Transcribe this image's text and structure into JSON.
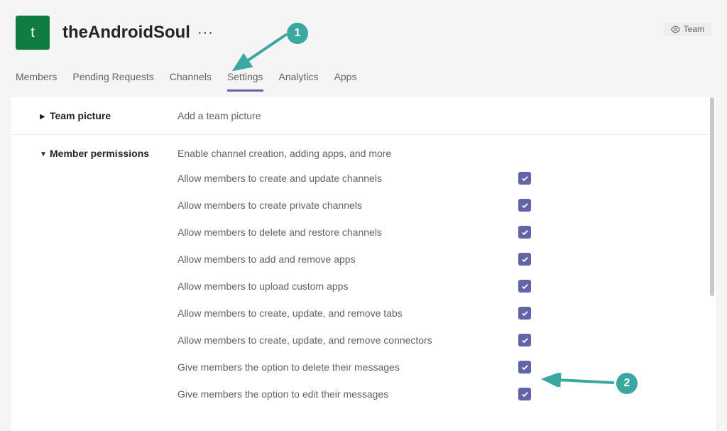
{
  "header": {
    "avatar_letter": "t",
    "team_name": "theAndroidSoul",
    "more": "···",
    "badge_label": "Team"
  },
  "tabs": [
    {
      "label": "Members",
      "active": false
    },
    {
      "label": "Pending Requests",
      "active": false
    },
    {
      "label": "Channels",
      "active": false
    },
    {
      "label": "Settings",
      "active": true
    },
    {
      "label": "Analytics",
      "active": false
    },
    {
      "label": "Apps",
      "active": false
    }
  ],
  "sections": {
    "team_picture": {
      "title": "Team picture",
      "desc": "Add a team picture",
      "expanded": false
    },
    "member_permissions": {
      "title": "Member permissions",
      "desc": "Enable channel creation, adding apps, and more",
      "expanded": true
    }
  },
  "permissions": [
    {
      "label": "Allow members to create and update channels",
      "checked": true
    },
    {
      "label": "Allow members to create private channels",
      "checked": true
    },
    {
      "label": "Allow members to delete and restore channels",
      "checked": true
    },
    {
      "label": "Allow members to add and remove apps",
      "checked": true
    },
    {
      "label": "Allow members to upload custom apps",
      "checked": true
    },
    {
      "label": "Allow members to create, update, and remove tabs",
      "checked": true
    },
    {
      "label": "Allow members to create, update, and remove connectors",
      "checked": true
    },
    {
      "label": "Give members the option to delete their messages",
      "checked": true
    },
    {
      "label": "Give members the option to edit their messages",
      "checked": true
    }
  ],
  "annotations": {
    "one": "1",
    "two": "2"
  }
}
